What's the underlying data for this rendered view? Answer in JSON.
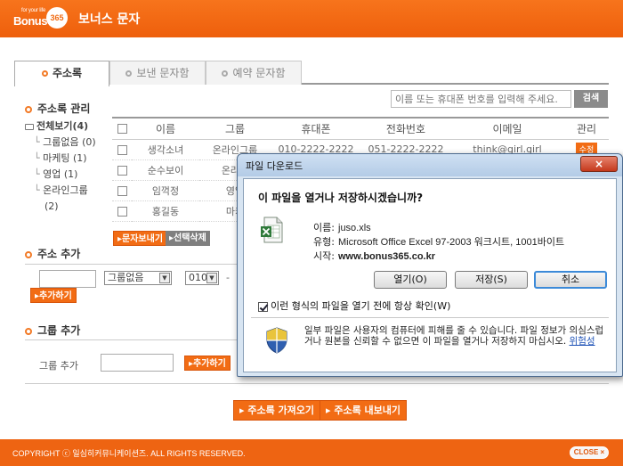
{
  "header": {
    "logo_small": "for your life",
    "logo_text": "Bonus",
    "logo_num": "365",
    "title": "보너스 문자"
  },
  "tabs": [
    {
      "label": "주소록",
      "active": true
    },
    {
      "label": "보낸 문자함",
      "active": false
    },
    {
      "label": "예약 문자함",
      "active": false
    }
  ],
  "address_mgmt": {
    "heading": "주소록 관리",
    "search_placeholder": "이름 또는 휴대폰 번호를 입력해 주세요.",
    "search_button": "검색",
    "tree": {
      "root": "전체보기(4)",
      "items": [
        {
          "label": "그룹없음 (0)"
        },
        {
          "label": "마케팅 (1)"
        },
        {
          "label": "영업 (1)"
        },
        {
          "label": "온라인그룹"
        },
        {
          "label": "(2)"
        }
      ]
    },
    "table": {
      "headers": [
        "이름",
        "그룹",
        "휴대폰",
        "전화번호",
        "이메일",
        "관리"
      ],
      "rows": [
        {
          "name": "생각소녀",
          "group": "온라인그룹",
          "mobile": "010-2222-2222",
          "phone": "051-2222-2222",
          "email": "think@girl.girl",
          "action": "수정"
        },
        {
          "name": "순수보이",
          "group": "온라인",
          "mobile": "",
          "phone": "",
          "email": "",
          "action": ""
        },
        {
          "name": "임꺽정",
          "group": "영업",
          "mobile": "",
          "phone": "",
          "email": "",
          "action": ""
        },
        {
          "name": "홍길동",
          "group": "마케",
          "mobile": "",
          "phone": "",
          "email": "",
          "action": ""
        }
      ]
    },
    "send_sms_button": "문자보내기",
    "delete_selected_button": "선택삭제"
  },
  "address_add": {
    "heading": "주소 추가",
    "group_select": "그룹없음",
    "phone_prefix": "010",
    "dash": "-",
    "add_button": "추가하기"
  },
  "group_add": {
    "heading": "그룹 추가",
    "label": "그룹 추가",
    "add_button": "추가하기"
  },
  "bottom_buttons": {
    "import": "주소록 가져오기",
    "export": "주소록 내보내기"
  },
  "footer": {
    "copyright": "COPYRIGHT ⓒ 일심히커뮤니케이션즈. ALL RIGHTS RESERVED.",
    "close": "CLOSE ×"
  },
  "dialog": {
    "title": "파일 다운로드",
    "close": "×",
    "question": "이 파일을 열거나 저장하시겠습니까?",
    "name_label": "이름:",
    "name_value": "juso.xls",
    "type_label": "유형:",
    "type_value": "Microsoft Office Excel 97-2003 워크시트, 1001바이트",
    "from_label": "시작:",
    "from_value": "www.bonus365.co.kr",
    "open_button": "열기(O)",
    "save_button": "저장(S)",
    "cancel_button": "취소",
    "checkbox_label": "이런 형식의 파일을 열기 전에 항상 확인(W)",
    "checkbox_checked": true,
    "warning_text": "일부 파일은 사용자의 컴퓨터에 피해를 줄 수 있습니다. 파일 정보가 의심스럽거나 원본을 신뢰할 수 없으면 이 파일을 열거나 저장하지 마십시오.",
    "warning_link": "위험성"
  },
  "icons": [
    "excel-file-icon",
    "shield-icon",
    "folder-icon"
  ],
  "colors": {
    "accent": "#f26c14",
    "dialog_frame": "#d8e5f2"
  }
}
